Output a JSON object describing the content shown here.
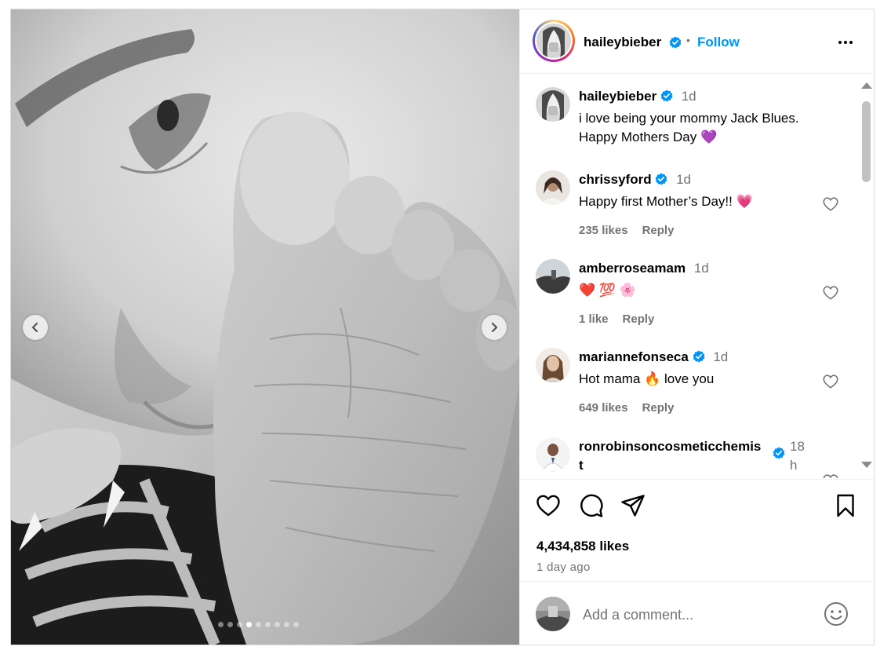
{
  "post": {
    "author": "haileybieber",
    "follow_label": "Follow",
    "separator": "•",
    "caption_line1": "i love being your mommy Jack Blues.",
    "caption_line2": "Happy Mothers Day 💜",
    "caption_time": "1d",
    "likes": "4,434,858 likes",
    "posted_ago": "1 day ago",
    "carousel": {
      "total_slides": 9,
      "active_index": 3
    }
  },
  "comments": [
    {
      "username": "chrissyford",
      "verified": true,
      "time": "1d",
      "text": "Happy first Mother’s Day!! 💗",
      "likes": "235 likes",
      "reply": "Reply"
    },
    {
      "username": "amberroseamam",
      "verified": false,
      "time": "1d",
      "text": "❤️ 💯 🌸",
      "likes": "1 like",
      "reply": "Reply"
    },
    {
      "username": "mariannefonseca",
      "verified": true,
      "time": "1d",
      "text": "Hot mama 🔥 love you",
      "likes": "649 likes",
      "reply": "Reply"
    },
    {
      "username": "ronrobinsoncosmeticchemis",
      "username_wrap": "t",
      "verified": true,
      "time": "18",
      "time_wrap": "h"
    }
  ],
  "add_comment": {
    "placeholder": "Add a comment..."
  },
  "colors": {
    "accent": "#0095f6",
    "verified": "#0095f6",
    "muted": "#737373",
    "border": "#dbdbdb"
  },
  "icons": [
    "chevron-left-icon",
    "chevron-right-icon",
    "more-icon",
    "verified-icon",
    "heart-icon",
    "comment-icon",
    "share-icon",
    "bookmark-icon",
    "emoji-icon"
  ]
}
